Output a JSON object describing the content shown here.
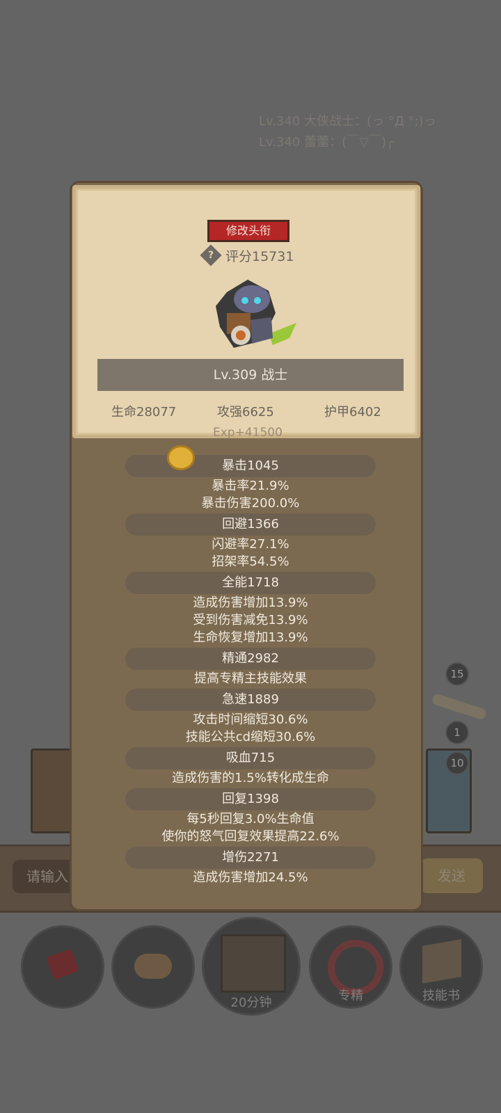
{
  "background": {
    "chat_lines": [
      "Lv.340 大侠战士：(っ °Д °;)っ",
      "Lv.340 蕾蕾：(￣▽￣)╭"
    ],
    "input_placeholder": "请输入",
    "send_label": "发送",
    "badges": [
      "15",
      "1",
      "10"
    ],
    "bottom_buttons": [
      {
        "icon": "potion-icon",
        "label": ""
      },
      {
        "icon": "bread-icon",
        "label": ""
      },
      {
        "icon": "chest-icon",
        "label": "20分钟"
      },
      {
        "icon": "specialization-icon",
        "label": "专精"
      },
      {
        "icon": "skill-book-icon",
        "label": "技能书"
      }
    ]
  },
  "card": {
    "edit_title_label": "修改头衔",
    "score_label": "评分15731",
    "level_class": "Lv.309 战士",
    "hp": "生命28077",
    "attack": "攻强6625",
    "armor": "护甲6402",
    "exp": "Exp+41500"
  },
  "stats": [
    {
      "header": "暴击1045",
      "details": [
        "暴击率21.9%",
        "暴击伤害200.0%"
      ]
    },
    {
      "header": "回避1366",
      "details": [
        "闪避率27.1%",
        "招架率54.5%"
      ]
    },
    {
      "header": "全能1718",
      "details": [
        "造成伤害增加13.9%",
        "受到伤害减免13.9%",
        "生命恢复增加13.9%"
      ]
    },
    {
      "header": "精通2982",
      "details": [
        "提高专精主技能效果"
      ]
    },
    {
      "header": "急速1889",
      "details": [
        "攻击时间缩短30.6%",
        "技能公共cd缩短30.6%"
      ]
    },
    {
      "header": "吸血715",
      "details": [
        "造成伤害的1.5%转化成生命"
      ]
    },
    {
      "header": "回复1398",
      "details": [
        "每5秒回复3.0%生命值",
        "使你的怒气回复效果提高22.6%"
      ]
    },
    {
      "header": "增伤2271",
      "details": [
        "造成伤害增加24.5%"
      ]
    }
  ]
}
